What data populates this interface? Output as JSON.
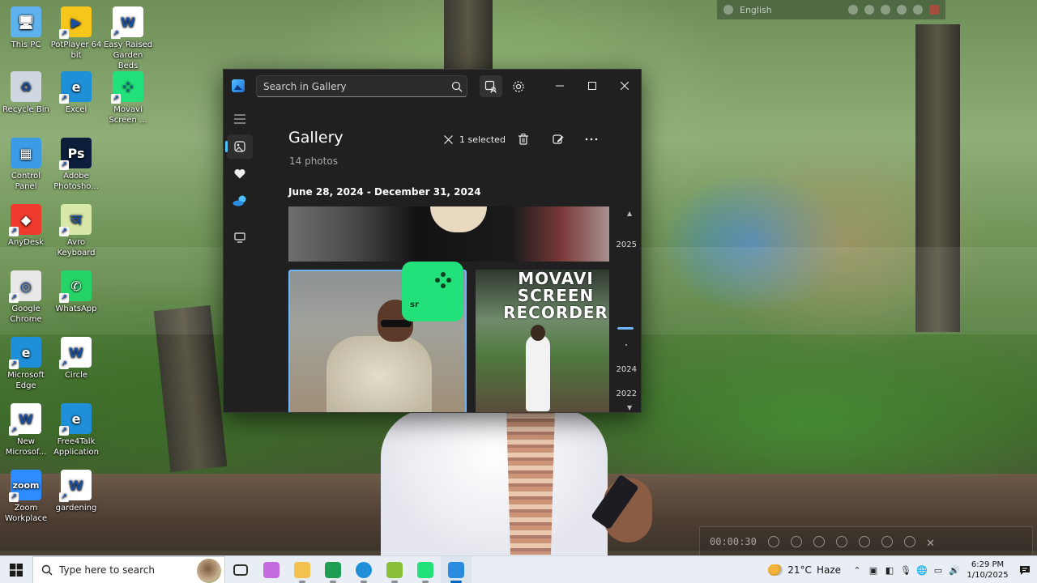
{
  "desktop": {
    "icons": [
      {
        "label": "This PC",
        "color": "#5fb2ee",
        "glyph": "🖥",
        "shortcut": false
      },
      {
        "label": "PotPlayer 64 bit",
        "color": "#f7c61b",
        "glyph": "▶",
        "shortcut": true
      },
      {
        "label": "Easy Raised Garden Beds",
        "color": "#ffffff",
        "glyph": "W",
        "shortcut": true
      },
      {
        "label": "Recycle Bin",
        "color": "#cfd8e0",
        "glyph": "♻",
        "shortcut": false
      },
      {
        "label": "Excel",
        "color": "#1e90d8",
        "glyph": "e",
        "shortcut": true
      },
      {
        "label": "Movavi Screen ...",
        "color": "#22e07a",
        "glyph": "⁘",
        "shortcut": true
      },
      {
        "label": "Control Panel",
        "color": "#3d9be6",
        "glyph": "▦",
        "shortcut": false
      },
      {
        "label": "Adobe Photosho...",
        "color": "#0c1e3c",
        "glyph": "Ps",
        "shortcut": true
      },
      {
        "label": "AnyDesk",
        "color": "#ef3b2d",
        "glyph": "◆",
        "shortcut": true
      },
      {
        "label": "Avro Keyboard",
        "color": "#d8e8a8",
        "glyph": "অ",
        "shortcut": true
      },
      {
        "label": "Google Chrome",
        "color": "#e8e8e8",
        "glyph": "◎",
        "shortcut": true
      },
      {
        "label": "WhatsApp",
        "color": "#25d366",
        "glyph": "✆",
        "shortcut": true
      },
      {
        "label": "Microsoft Edge",
        "color": "#1e8fd8",
        "glyph": "e",
        "shortcut": true
      },
      {
        "label": "Circle",
        "color": "#ffffff",
        "glyph": "W",
        "shortcut": true
      },
      {
        "label": "New Microsof...",
        "color": "#ffffff",
        "glyph": "W",
        "shortcut": true
      },
      {
        "label": "Free4Talk Application",
        "color": "#1e8fd8",
        "glyph": "e",
        "shortcut": true
      },
      {
        "label": "Zoom Workplace",
        "color": "#2d8cff",
        "glyph": "zoom",
        "shortcut": true
      },
      {
        "label": "gardening",
        "color": "#ffffff",
        "glyph": "W",
        "shortcut": true
      }
    ]
  },
  "float_bar": {
    "language": "English"
  },
  "recorder": {
    "timer": "00:00:30"
  },
  "window": {
    "search_placeholder": "Search in Gallery",
    "title": "Gallery",
    "photo_count": "14 photos",
    "selection_label": "1 selected",
    "date_range": "June 28, 2024 - December 31, 2024",
    "years": [
      "2025",
      "2024",
      "2022"
    ],
    "watermark_text": "MOVAVI\nSCREEN\nRECORDER",
    "watermark_mini": "sr"
  },
  "taskbar": {
    "search_placeholder": "Type here to search",
    "weather_temp": "21°C",
    "weather_desc": "Haze",
    "time": "6:29 PM",
    "date": "1/10/2025",
    "apps": [
      {
        "name": "taskview",
        "color": "#444"
      },
      {
        "name": "copilot",
        "color": "#c46be0"
      },
      {
        "name": "file-explorer",
        "color": "#f2c14e"
      },
      {
        "name": "excel-sheet",
        "color": "#1f9d55"
      },
      {
        "name": "edge",
        "color": "#1e8fd8"
      },
      {
        "name": "garden-app",
        "color": "#8bbf3a"
      },
      {
        "name": "movavi",
        "color": "#22e07a"
      },
      {
        "name": "photos",
        "color": "#2a8be0"
      }
    ]
  }
}
